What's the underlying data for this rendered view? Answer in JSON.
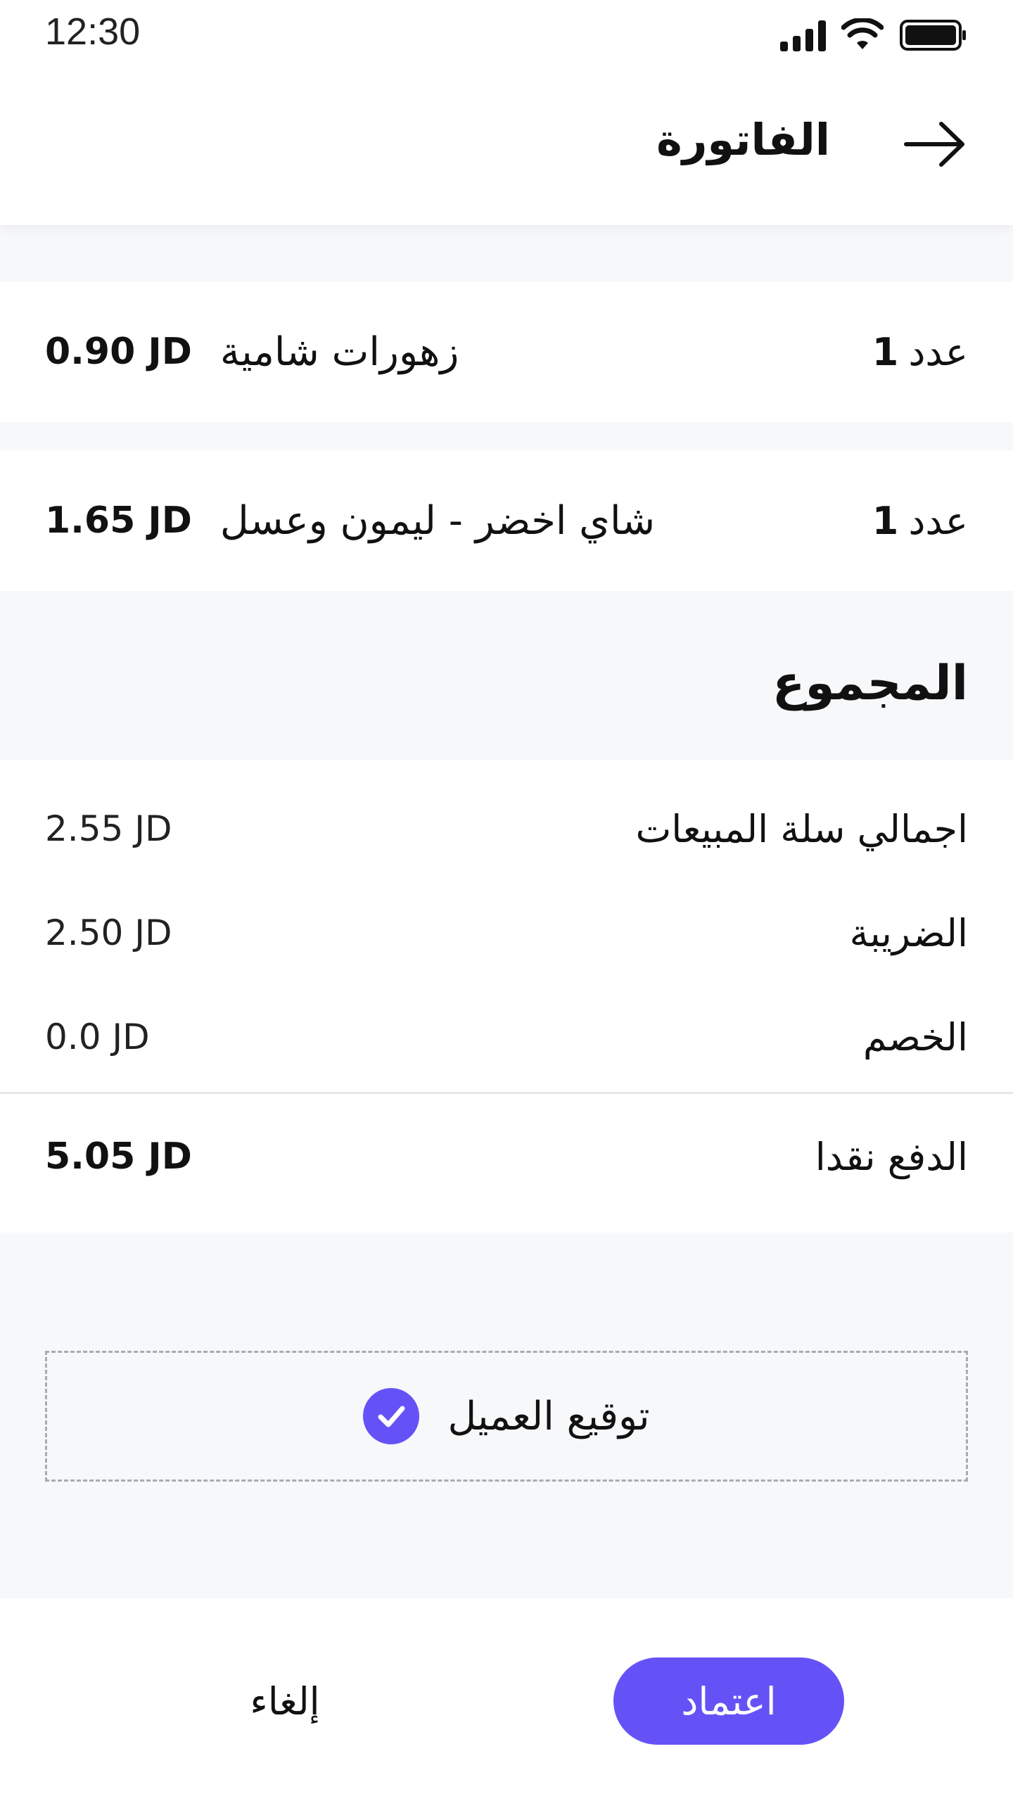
{
  "status_bar": {
    "time": "12:30",
    "icons": [
      "signal-icon",
      "wifi-icon",
      "battery-icon"
    ]
  },
  "header": {
    "title": "الفاتورة",
    "back_icon": "arrow-right-icon"
  },
  "items": [
    {
      "qty_label": "عدد",
      "qty": "1",
      "name": "زهورات شامية",
      "price": "0.90 JD"
    },
    {
      "qty_label": "عدد",
      "qty": "1",
      "name": "شاي اخضر - ليمون وعسل",
      "price": "1.65 JD"
    }
  ],
  "totals": {
    "title": "المجموع",
    "rows": [
      {
        "label": "اجمالي سلة المبيعات",
        "value": "2.55 JD"
      },
      {
        "label": "الضريبة",
        "value": "2.50 JD"
      },
      {
        "label": "الخصم",
        "value": "0.0 JD"
      }
    ],
    "grand": {
      "label": "الدفع نقدا",
      "value": "5.05 JD"
    }
  },
  "signature": {
    "label": "توقيع العميل",
    "check_icon": "check-circle-icon"
  },
  "actions": {
    "confirm_label": "اعتماد",
    "cancel_label": "إلغاء"
  },
  "colors": {
    "accent": "#6552f7",
    "background_gray": "#f7f8fa",
    "text": "#111111"
  }
}
